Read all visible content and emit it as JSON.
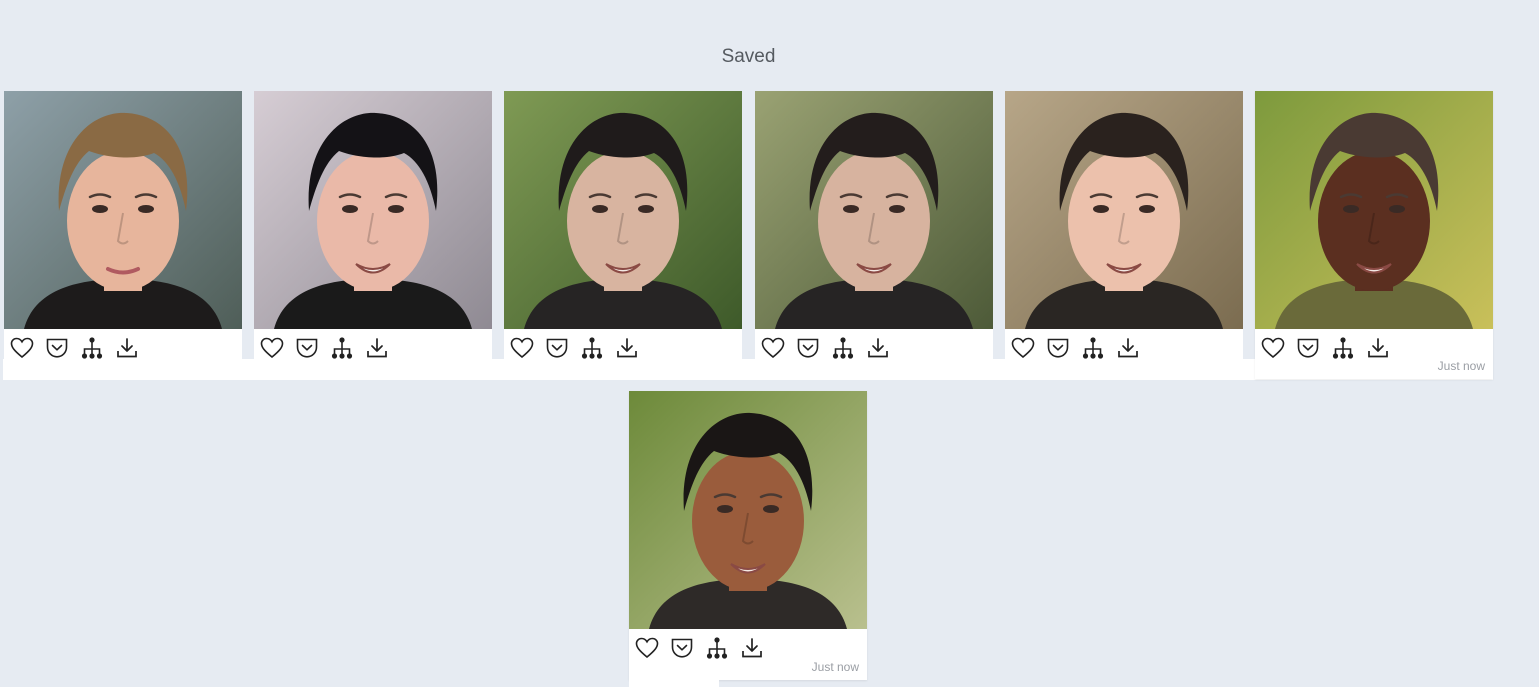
{
  "page": {
    "title": "Saved"
  },
  "actions": {
    "like_icon": "heart-outline-icon",
    "save_icon": "pocket-save-icon",
    "lineage_icon": "hierarchy-tree-icon",
    "download_icon": "download-icon"
  },
  "cards": [
    {
      "label": "portrait-1",
      "timestamp": "",
      "skin": "#e7b59c",
      "hair": "#8a6a44",
      "bg1": "#8ea0a8",
      "bg2": "#4f5e58",
      "cloth": "#1d1b1b",
      "smile": false
    },
    {
      "label": "portrait-2",
      "timestamp": "",
      "skin": "#eab9a8",
      "hair": "#141216",
      "bg1": "#d6cdd4",
      "bg2": "#8f8a93",
      "cloth": "#1a1a1a",
      "smile": true
    },
    {
      "label": "portrait-3",
      "timestamp": "",
      "skin": "#d8b4a0",
      "hair": "#1f1b1b",
      "bg1": "#7f9a54",
      "bg2": "#3e5a2a",
      "cloth": "#262424",
      "smile": true
    },
    {
      "label": "portrait-4",
      "timestamp": "",
      "skin": "#d7b39f",
      "hair": "#231d1c",
      "bg1": "#9aa273",
      "bg2": "#4d5a38",
      "cloth": "#262424",
      "smile": true
    },
    {
      "label": "portrait-5",
      "timestamp": "",
      "skin": "#ecc1ac",
      "hair": "#2a221e",
      "bg1": "#b7a688",
      "bg2": "#7b6c50",
      "cloth": "#2a2623",
      "smile": true
    },
    {
      "label": "portrait-6",
      "timestamp": "Just now",
      "skin": "#5b2f20",
      "hair": "#4a3a33",
      "bg1": "#7d9a3d",
      "bg2": "#c9c05a",
      "cloth": "#6a6a3a",
      "smile": true
    },
    {
      "label": "portrait-7",
      "timestamp": "Just now",
      "skin": "#9a5c3c",
      "hair": "#1a1615",
      "bg1": "#6d8a3a",
      "bg2": "#b9c08e",
      "cloth": "#2e2a28",
      "smile": true
    }
  ]
}
